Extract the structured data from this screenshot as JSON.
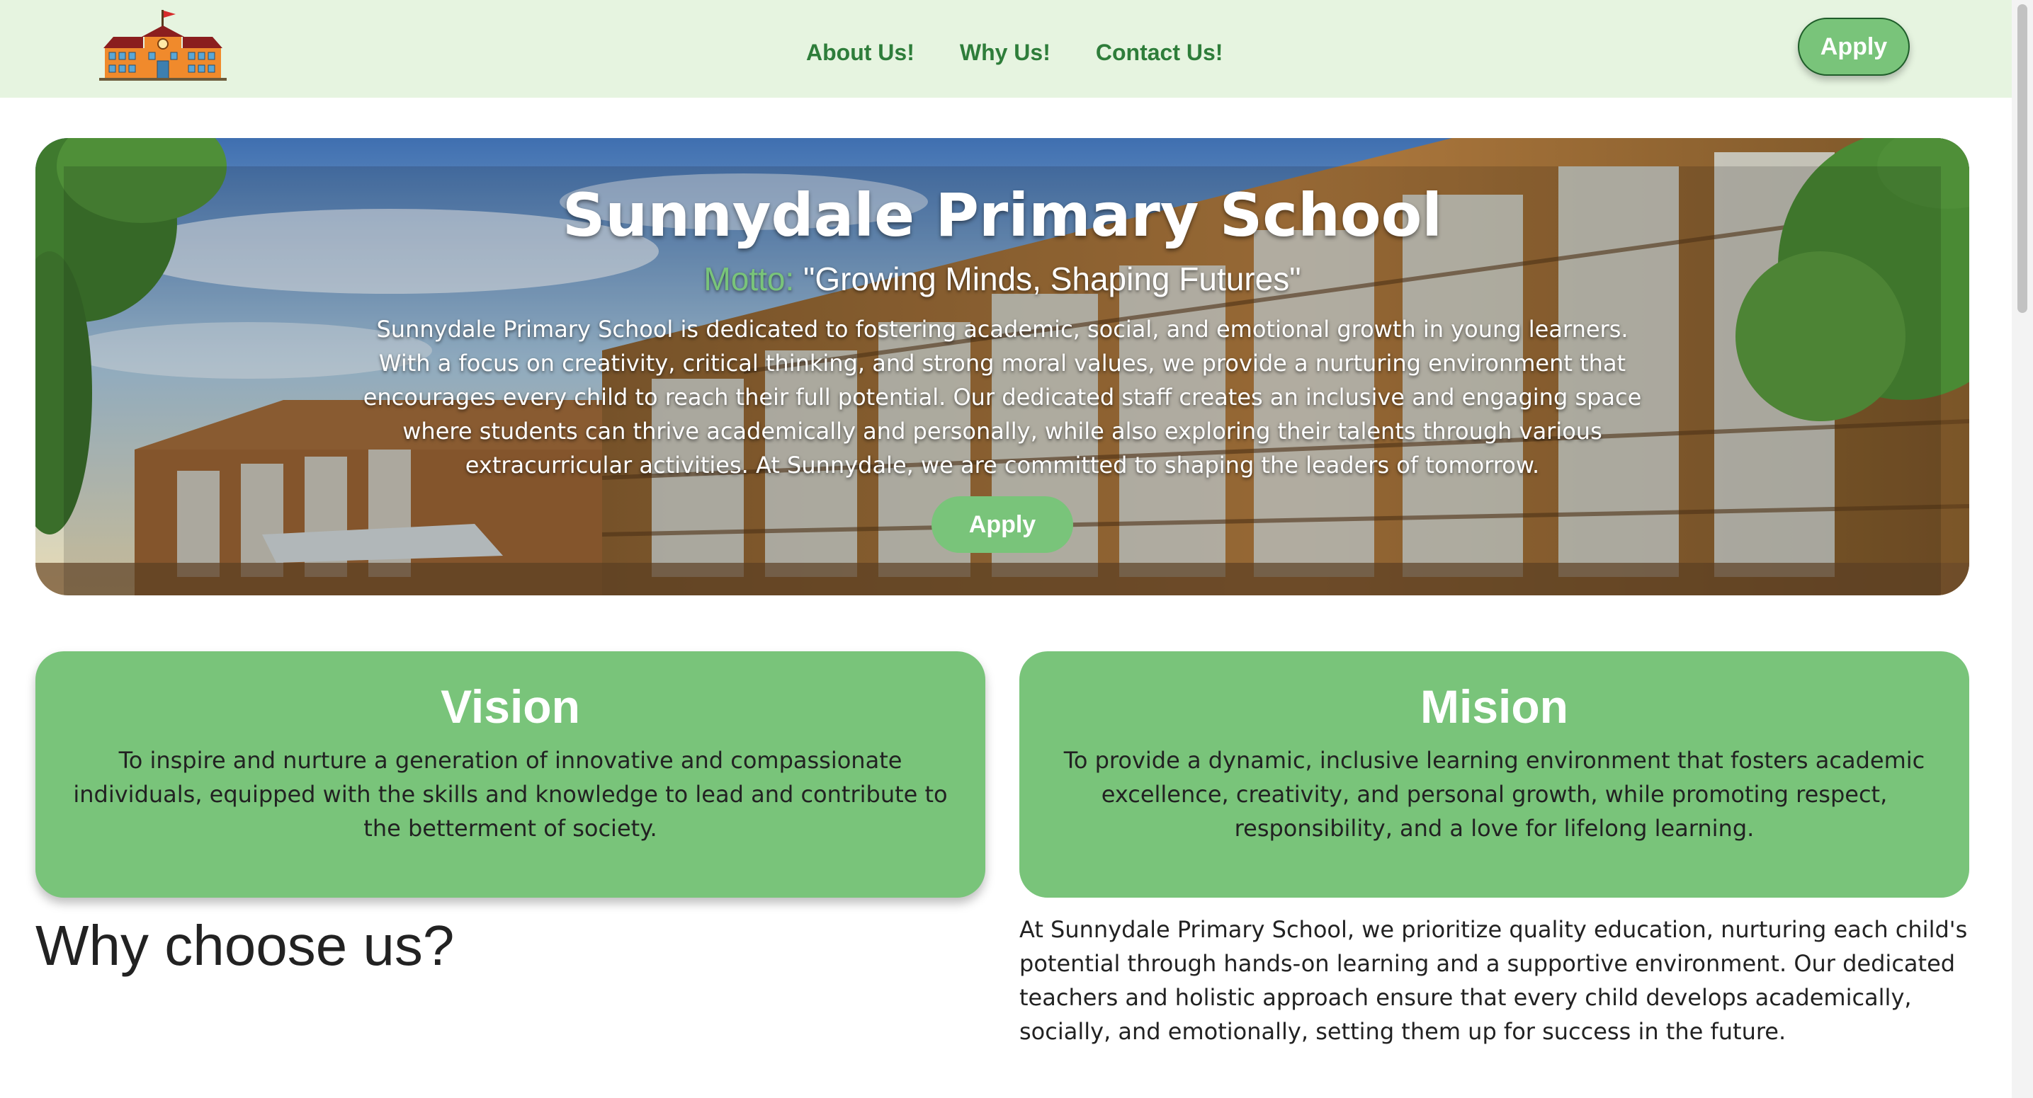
{
  "header": {
    "logo_icon": "school-building-icon",
    "nav": [
      {
        "label": "About Us!"
      },
      {
        "label": "Why Us!"
      },
      {
        "label": "Contact Us!"
      }
    ],
    "apply_label": "Apply"
  },
  "hero": {
    "title": "Sunnydale Primary School",
    "motto_label": "Motto:",
    "motto_text": " \"Growing Minds, Shaping Futures\"",
    "description": "Sunnydale Primary School is dedicated to fostering academic, social, and emotional growth in young learners. With a focus on creativity, critical thinking, and strong moral values, we provide a nurturing environment that encourages every child to reach their full potential. Our dedicated staff creates an inclusive and engaging space where students can thrive academically and personally, while also exploring their talents through various extracurricular activities. At Sunnydale, we are committed to shaping the leaders of tomorrow.",
    "apply_label": "Apply"
  },
  "vision": {
    "title": "Vision",
    "text": "To inspire and nurture a generation of innovative and compassionate individuals, equipped with the skills and knowledge to lead and contribute to the betterment of society."
  },
  "mission": {
    "title": "Mision",
    "text": "To provide a dynamic, inclusive learning environment that fosters academic excellence, creativity, and personal growth, while promoting respect, responsibility, and a love for lifelong learning."
  },
  "why": {
    "title": "Why choose us?",
    "text": "At Sunnydale Primary School, we prioritize quality education, nurturing each child's potential through hands-on learning and a supportive environment. Our dedicated teachers and holistic approach ensure that every child develops academically, socially, and emotionally, setting them up for success in the future."
  },
  "colors": {
    "header_bg": "#e6f4e0",
    "accent_green": "#79c47a",
    "nav_text": "#2e7d3a"
  }
}
